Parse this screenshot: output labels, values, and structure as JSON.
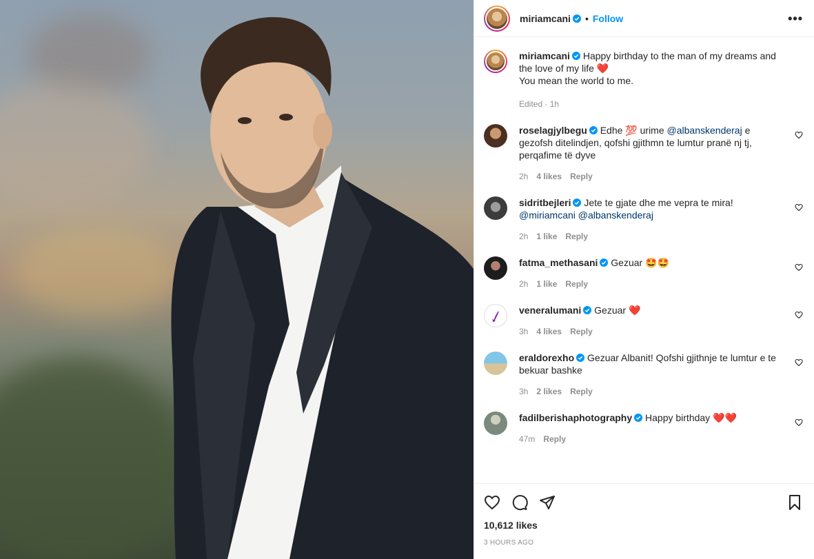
{
  "header": {
    "username": "miriamcani",
    "follow_label": "Follow",
    "more_label": "•••"
  },
  "caption": {
    "username": "miriamcani",
    "line1": "Happy birthday to the man of my dreams and the love of my life",
    "line2": "You mean the world to me.",
    "emoji": "❤️",
    "meta": "Edited · 1h"
  },
  "comments": [
    {
      "username": "roselagjylbegu",
      "text_pre": "Edhe",
      "emoji": "💯",
      "text_mid": "urime",
      "mention": "@albanskenderaj",
      "text_post": "e gezofsh ditelindjen, qofshi gjithmn te lumtur pranë nj tj, perqafime të dyve",
      "time": "2h",
      "likes": "4 likes",
      "reply": "Reply"
    },
    {
      "username": "sidritbejleri",
      "text": "Jete te gjate dhe me vepra te mira!",
      "mention1": "@miriamcani",
      "mention2": "@albanskenderaj",
      "time": "2h",
      "likes": "1 like",
      "reply": "Reply"
    },
    {
      "username": "fatma_methasani",
      "text": "Gezuar",
      "emoji": "🤩🤩",
      "time": "2h",
      "likes": "1 like",
      "reply": "Reply"
    },
    {
      "username": "veneralumani",
      "text": "Gezuar",
      "emoji": "❤️",
      "time": "3h",
      "likes": "4 likes",
      "reply": "Reply"
    },
    {
      "username": "eraldorexho",
      "text": "Gezuar Albanit! Qofshi gjithnje te lumtur e te bekuar bashke",
      "time": "3h",
      "likes": "2 likes",
      "reply": "Reply"
    },
    {
      "username": "fadilberishaphotography",
      "text": "Happy birthday",
      "emoji": "❤️❤️",
      "time": "47m",
      "reply": "Reply"
    }
  ],
  "footer": {
    "likes": "10,612 likes",
    "ago": "3 HOURS AGO"
  },
  "colors": {
    "accent": "#0095f6",
    "mention": "#00376b",
    "verified": "#0095f6",
    "muted": "#8e8e8e"
  }
}
